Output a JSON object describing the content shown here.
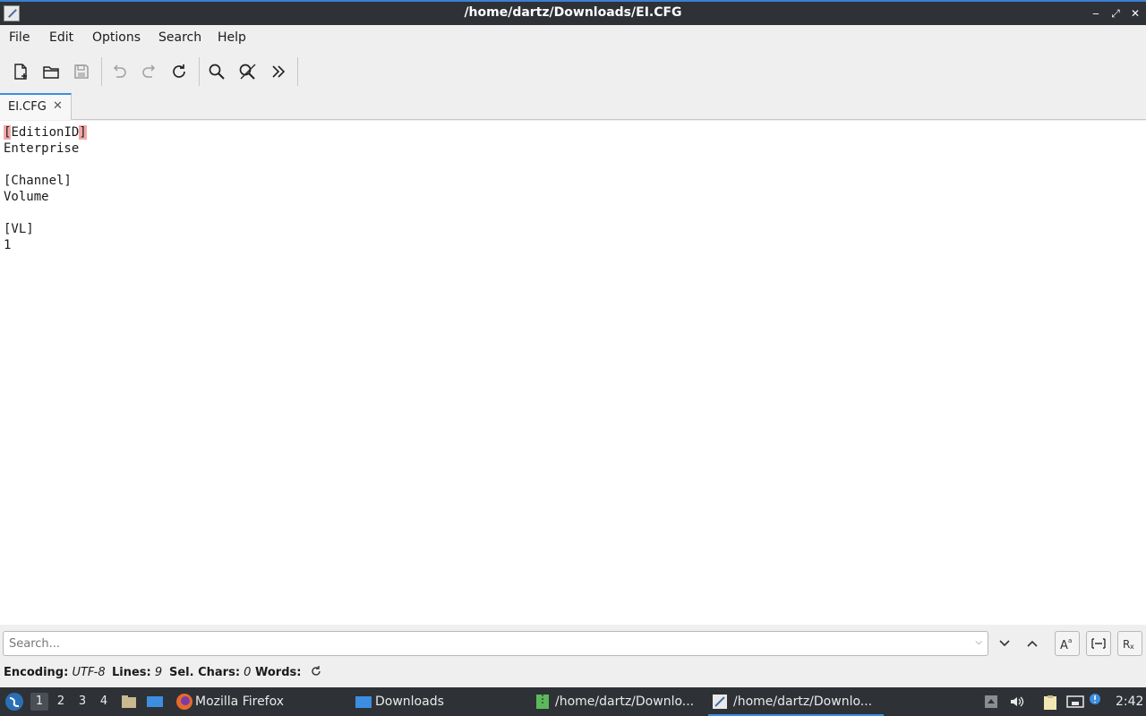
{
  "window": {
    "title": "/home/dartz/Downloads/EI.CFG"
  },
  "menu": [
    "File",
    "Edit",
    "Options",
    "Search",
    "Help"
  ],
  "toolbar": {
    "new": "new-file-icon",
    "open": "open-folder-icon",
    "save": "save-icon",
    "undo": "undo-icon",
    "redo": "redo-icon",
    "reload": "reload-icon",
    "find": "search-icon",
    "replace": "find-replace-icon",
    "more": "more-icon"
  },
  "tab": {
    "label": "EI.CFG"
  },
  "editor": {
    "lines": [
      "[EditionID]",
      "Enterprise",
      "",
      "[Channel]",
      "Volume",
      "",
      "[VL]",
      "1"
    ],
    "first_line": {
      "open": "[",
      "text": "EditionID",
      "close": "]"
    }
  },
  "search": {
    "placeholder": "Search..."
  },
  "status": {
    "encoding_label": "Encoding:",
    "encoding_value": "UTF-8",
    "lines_label": "Lines:",
    "lines_value": "9",
    "sel_label": "Sel. Chars:",
    "sel_value": "0",
    "words_label": "Words:"
  },
  "taskbar": {
    "workspaces": [
      "1",
      "2",
      "3",
      "4"
    ],
    "tasks": [
      {
        "label": "Mozilla Firefox"
      },
      {
        "label": "Downloads"
      },
      {
        "label": "/home/dartz/Downlo..."
      },
      {
        "label": "/home/dartz/Downlo..."
      }
    ],
    "clock": "2:42"
  },
  "colors": {
    "accent": "#3d8ee0",
    "bracket_highlight": "#f3a7a7",
    "panel": "#2e3136"
  }
}
